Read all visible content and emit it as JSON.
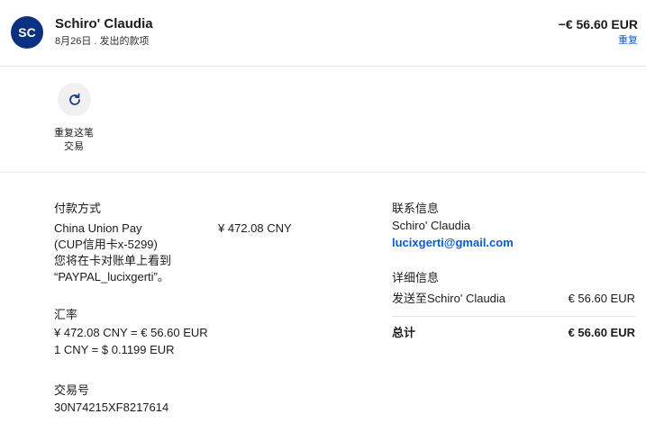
{
  "header": {
    "avatar_initials": "SC",
    "merchant_name": "Schiro' Claudia",
    "subtitle": "8月26日 . 发出的款项",
    "amount": "−€ 56.60 EUR",
    "refund_link": "重复"
  },
  "actions": {
    "repeat_label_line1": "重复这笔",
    "repeat_label_line2": "交易",
    "icon": "refresh-icon"
  },
  "payment": {
    "title": "付款方式",
    "method_line1": "China Union Pay",
    "method_line2": "(CUP信用卡x-5299)",
    "note_line1": "您将在卡对账单上看到",
    "note_line2": "“PAYPAL_lucixgerti”。",
    "amount_cny": "¥ 472.08 CNY"
  },
  "exchange": {
    "title": "汇率",
    "line1": "¥ 472.08 CNY = € 56.60 EUR",
    "line2": "1 CNY = $ 0.1199 EUR"
  },
  "transaction": {
    "title": "交易号",
    "id": "30N74215XF8217614"
  },
  "contact": {
    "title": "联系信息",
    "name": "Schiro' Claudia",
    "email": "lucixgerti@gmail.com"
  },
  "detail": {
    "title": "详细信息",
    "sent_to": "发送至Schiro' Claudia",
    "sent_amount": "€ 56.60 EUR",
    "total_label": "总计",
    "total_amount": "€ 56.60 EUR"
  },
  "colors": {
    "avatar_bg": "#0b3281",
    "link": "#0a5bd6"
  }
}
